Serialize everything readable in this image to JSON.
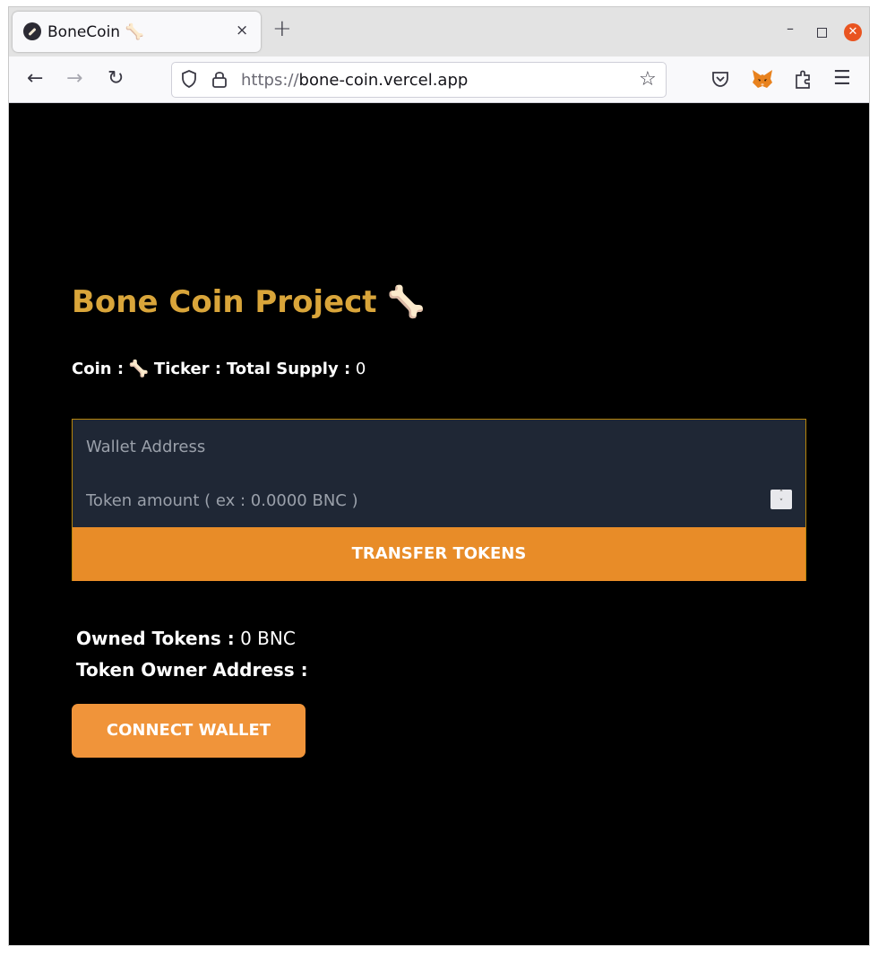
{
  "browser": {
    "tab_title": "BoneCoin 🦴",
    "tab_close": "×",
    "new_tab": "+",
    "win_minimize": "–",
    "win_close": "✕",
    "url_scheme": "https://",
    "url_host": "bone-coin.vercel.app"
  },
  "page": {
    "title": "Bone Coin Project 🦴",
    "coin_label": "Coin :",
    "coin_value": "🦴",
    "ticker_label": "Ticker :",
    "ticker_value": "",
    "supply_label": "Total Supply :",
    "supply_value": "0",
    "wallet_placeholder": "Wallet Address",
    "amount_placeholder": "Token amount ( ex : 0.0000 BNC )",
    "transfer_button": "TRANSFER TOKENS",
    "owned_label": "Owned Tokens :",
    "owned_value": "0 BNC",
    "owner_label": "Token Owner Address :",
    "connect_button": "CONNECT WALLET"
  },
  "colors": {
    "title": "#d9a53a",
    "transfer_button": "#e88c28",
    "connect_button": "#f0943a",
    "form_bg": "#1f2735"
  }
}
